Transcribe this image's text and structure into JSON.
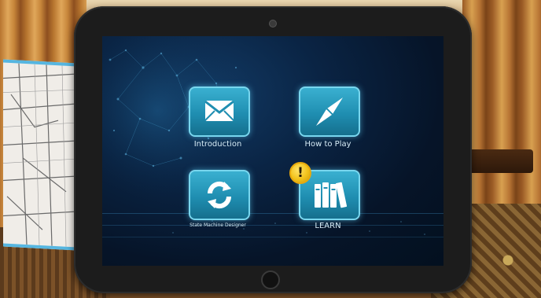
{
  "menu": {
    "items": [
      {
        "label": "Introduction",
        "icon": "envelope-icon"
      },
      {
        "label": "How to Play",
        "icon": "compass-icon"
      },
      {
        "label": "State Machine Designer",
        "icon": "refresh-arrows-icon"
      },
      {
        "label": "LEARN",
        "icon": "books-icon",
        "badge": "!"
      }
    ]
  },
  "colors": {
    "tile": "#1f8eb1",
    "tile_border": "#78d6ee",
    "badge": "#f2c21a",
    "screen_bg": "#0a2444",
    "label": "#d8eef8"
  }
}
